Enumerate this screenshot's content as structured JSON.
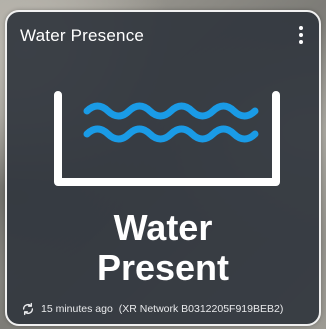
{
  "card": {
    "title": "Water Presence",
    "state_line1": "Water",
    "state_line2": "Present",
    "last_updated": "15 minutes ago",
    "source": "(XR Network B0312205F919BEB2)"
  },
  "icons": {
    "menu": "more-vertical-icon",
    "main": "water-tank-icon",
    "refresh": "refresh-icon"
  },
  "colors": {
    "card_background": "#32373e",
    "card_border": "#f1f1f1",
    "water_wave": "#1a9be6",
    "tank_outline": "#ffffff",
    "text": "#ffffff"
  }
}
